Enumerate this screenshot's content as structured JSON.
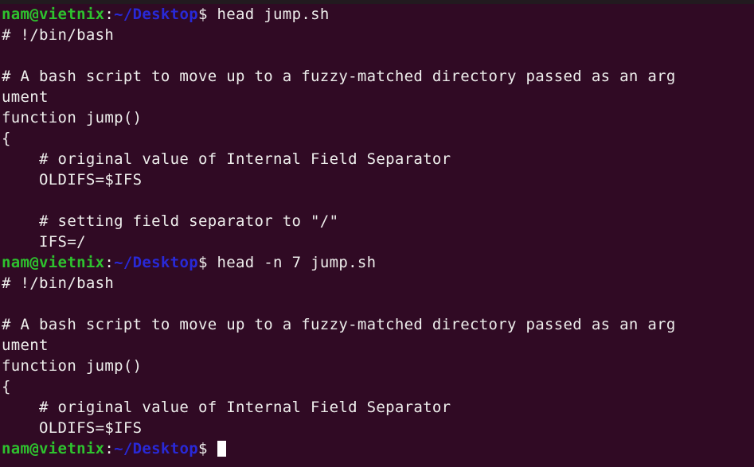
{
  "terminal": {
    "app_name": "Terminal",
    "background_color": "#300a24",
    "foreground_color": "#eeeeec",
    "prompt_user_color": "#2ec22e",
    "prompt_path_color": "#2929d7",
    "cursor_color": "#ffffff",
    "columns": 83,
    "rows": 22,
    "prompt": {
      "user_host": "nam@vietnix",
      "separator": ":",
      "path": "~/Desktop",
      "sigil": "$"
    },
    "lines": [
      {
        "type": "prompt",
        "command": " head jump.sh"
      },
      {
        "type": "output",
        "text": "# !/bin/bash"
      },
      {
        "type": "output",
        "text": ""
      },
      {
        "type": "output",
        "text": "# A bash script to move up to a fuzzy-matched directory passed as an arg"
      },
      {
        "type": "output",
        "text": "ument"
      },
      {
        "type": "output",
        "text": "function jump()"
      },
      {
        "type": "output",
        "text": "{"
      },
      {
        "type": "output",
        "text": "    # original value of Internal Field Separator"
      },
      {
        "type": "output",
        "text": "    OLDIFS=$IFS"
      },
      {
        "type": "output",
        "text": ""
      },
      {
        "type": "output",
        "text": "    # setting field separator to \"/\""
      },
      {
        "type": "output",
        "text": "    IFS=/"
      },
      {
        "type": "prompt",
        "command": " head -n 7 jump.sh"
      },
      {
        "type": "output",
        "text": "# !/bin/bash"
      },
      {
        "type": "output",
        "text": ""
      },
      {
        "type": "output",
        "text": "# A bash script to move up to a fuzzy-matched directory passed as an arg"
      },
      {
        "type": "output",
        "text": "ument"
      },
      {
        "type": "output",
        "text": "function jump()"
      },
      {
        "type": "output",
        "text": "{"
      },
      {
        "type": "output",
        "text": "    # original value of Internal Field Separator"
      },
      {
        "type": "output",
        "text": "    OLDIFS=$IFS"
      },
      {
        "type": "prompt",
        "command": " ",
        "cursor": true
      }
    ]
  }
}
